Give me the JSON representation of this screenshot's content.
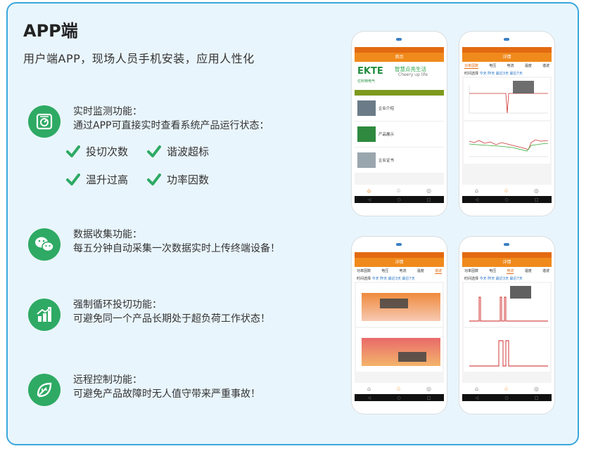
{
  "title": "APP端",
  "subtitle": "用户端APP，现场人员手机安装，应用人性化",
  "features": [
    {
      "head": "实时监测功能：",
      "desc": "通过APP可直接实时查看系统产品运行状态：",
      "icon": "monitor-icon"
    },
    {
      "head": "数据收集功能：",
      "desc": "每五分钟自动采集一次数据实时上传终端设备！",
      "icon": "wechat-icon"
    },
    {
      "head": "强制循环投切功能：",
      "desc": "可避免同一个产品长期处于超负荷工作状态！",
      "icon": "growth-chart-icon"
    },
    {
      "head": "远程控制功能：",
      "desc": "可避免产品故障时无人值守带来严重事故！",
      "icon": "leaf-icon"
    }
  ],
  "tags": [
    "投切次数",
    "谐波超标",
    "温升过高",
    "功率因数"
  ],
  "colors": {
    "accent": "#2eaa64",
    "border": "#3aa7de",
    "orange": "#f08a1c"
  },
  "phones": {
    "home": {
      "appbar": "首页",
      "brand": "EKTE",
      "slogan": "智慧点亮生活",
      "slogan_en": "Cheery up life",
      "brand_cn": "亿科特电气",
      "items": [
        "企业介绍",
        "产品展示",
        "企业证书"
      ]
    },
    "detail": {
      "appbar": "详情",
      "tabs": [
        "功率因数",
        "电压",
        "电流",
        "温度",
        "谐波"
      ],
      "selector": "时间选择",
      "range": "今天 昨天 最近3天 最近7天"
    }
  }
}
